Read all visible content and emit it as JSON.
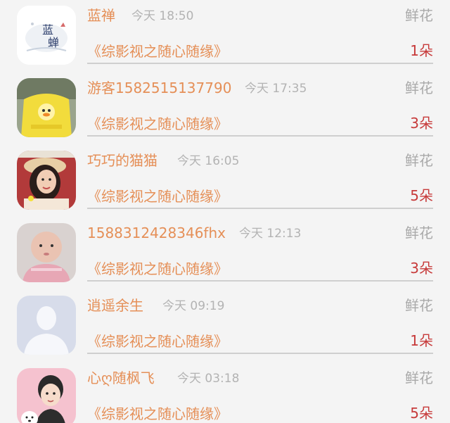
{
  "gifts": [
    {
      "user": "蓝禅",
      "time": "今天 18:50",
      "type": "鲜花",
      "work": "《综影视之随心随缘》",
      "count": "1朵",
      "avatar": "blue-zen-logo-icon"
    },
    {
      "user": "游客1582515137790",
      "time": "今天 17:35",
      "type": "鲜花",
      "work": "《综影视之随心随缘》",
      "count": "3朵",
      "avatar": "yellow-duck-sweater-photo"
    },
    {
      "user": "巧巧的猫猫",
      "time": "今天 16:05",
      "type": "鲜花",
      "work": "《综影视之随心随缘》",
      "count": "5朵",
      "avatar": "girl-straw-hat-photo"
    },
    {
      "user": "1588312428346fhx",
      "time": "今天 12:13",
      "type": "鲜花",
      "work": "《综影视之随心随缘》",
      "count": "3朵",
      "avatar": "baby-photo"
    },
    {
      "user": "逍遥余生",
      "time": "今天 09:19",
      "type": "鲜花",
      "work": "《综影视之随心随缘》",
      "count": "1朵",
      "avatar": "default-user-silhouette-icon"
    },
    {
      "user": "心ღ随枫飞",
      "time": "今天 03:18",
      "type": "鲜花",
      "work": "《综影视之随心随缘》",
      "count": "5朵",
      "avatar": "cartoon-boy-with-dog-icon"
    }
  ],
  "colors": {
    "accent": "#e58f57",
    "count": "#c73a3a",
    "muted": "#a9a9a9",
    "background": "#f4f4f4"
  }
}
